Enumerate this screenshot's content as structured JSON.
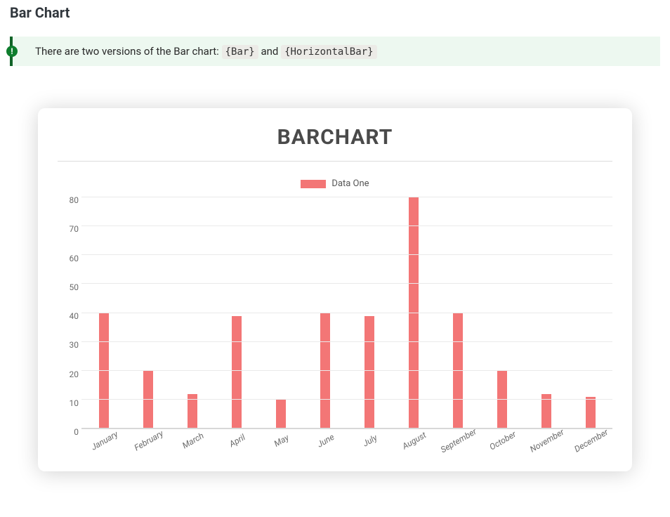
{
  "heading": "Bar Chart",
  "callout": {
    "text_before": "There are two versions of the Bar chart: ",
    "code1": "{Bar}",
    "middle": " and ",
    "code2": "{HorizontalBar}",
    "badge": "!"
  },
  "chart": {
    "title": "BARCHART",
    "legend": {
      "label": "Data One",
      "color": "#f37676"
    },
    "y_ticks": [
      "0",
      "10",
      "20",
      "30",
      "40",
      "50",
      "60",
      "70",
      "80"
    ]
  },
  "chart_data": {
    "type": "bar",
    "title": "BARCHART",
    "categories": [
      "January",
      "February",
      "March",
      "April",
      "May",
      "June",
      "July",
      "August",
      "September",
      "October",
      "November",
      "December"
    ],
    "series": [
      {
        "name": "Data One",
        "values": [
          40,
          20,
          12,
          39,
          10,
          40,
          39,
          80,
          40,
          20,
          12,
          11
        ]
      }
    ],
    "xlabel": "",
    "ylabel": "",
    "ylim": [
      0,
      80
    ]
  }
}
